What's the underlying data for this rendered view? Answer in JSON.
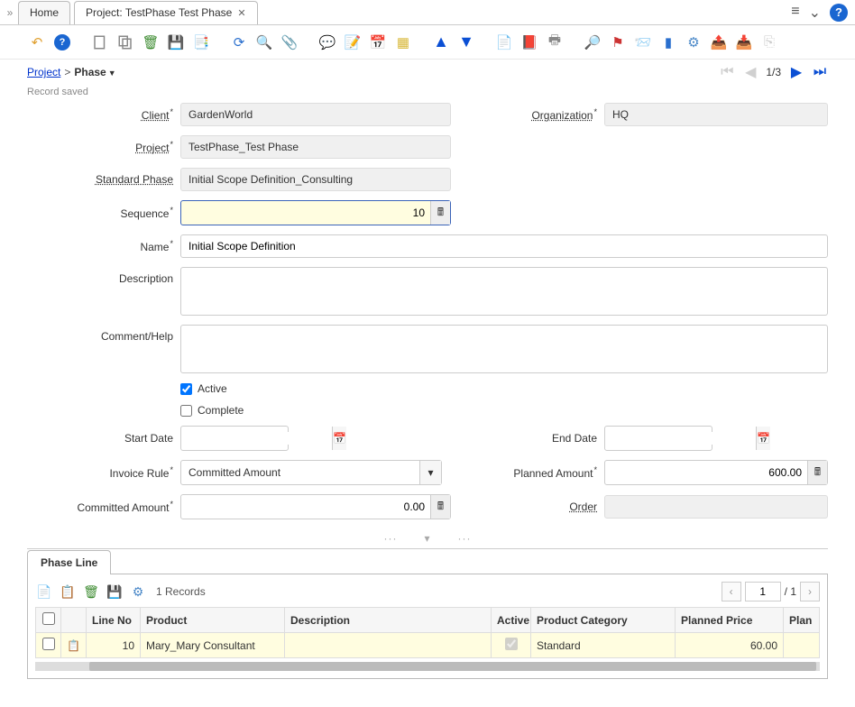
{
  "tabbar": {
    "home": "Home",
    "project": "Project: TestPhase Test Phase"
  },
  "breadcrumb": {
    "root": "Project",
    "current": "Phase"
  },
  "record_nav": {
    "position": "1/3"
  },
  "status": "Record saved",
  "labels": {
    "client": "Client",
    "organization": "Organization",
    "project": "Project",
    "standard_phase": "Standard Phase",
    "sequence": "Sequence",
    "name": "Name",
    "description": "Description",
    "comment": "Comment/Help",
    "active": "Active",
    "complete": "Complete",
    "start_date": "Start Date",
    "end_date": "End Date",
    "invoice_rule": "Invoice Rule",
    "planned_amount": "Planned Amount",
    "committed_amount": "Committed Amount",
    "order": "Order"
  },
  "fields": {
    "client": "GardenWorld",
    "organization": "HQ",
    "project": "TestPhase_Test Phase",
    "standard_phase": "Initial Scope Definition_Consulting",
    "sequence": "10",
    "name": "Initial Scope Definition",
    "description": "",
    "comment": "",
    "active": true,
    "complete": false,
    "start_date": "",
    "end_date": "",
    "invoice_rule": "Committed Amount",
    "planned_amount": "600.00",
    "committed_amount": "0.00",
    "order": ""
  },
  "detail": {
    "tab": "Phase Line",
    "records_label": "1 Records",
    "page": "1",
    "total_pages": "/ 1",
    "columns": {
      "line_no": "Line No",
      "product": "Product",
      "description": "Description",
      "active": "Active",
      "product_category": "Product Category",
      "planned_price": "Planned Price",
      "planned": "Plan"
    },
    "rows": [
      {
        "line_no": "10",
        "product": "Mary_Mary Consultant",
        "description": "",
        "active": true,
        "product_category": "Standard",
        "planned_price": "60.00"
      }
    ]
  }
}
